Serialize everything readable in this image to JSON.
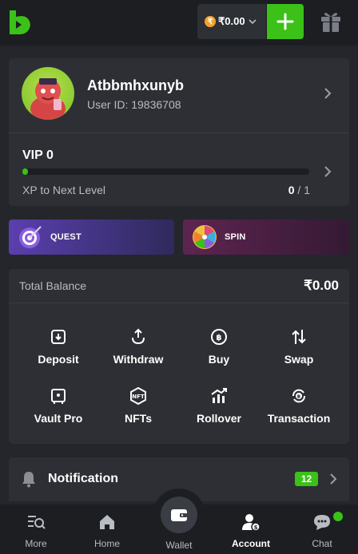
{
  "header": {
    "currency_symbol": "₹",
    "balance": "₹0.00",
    "accent": "#3bc117"
  },
  "profile": {
    "username": "Atbbmhxunyb",
    "user_id": "User ID: 19836708"
  },
  "vip": {
    "level": "VIP 0",
    "xp_label": "XP to Next Level",
    "xp_current": "0",
    "xp_sep": " / ",
    "xp_target": "1",
    "progress": 0.02
  },
  "banners": {
    "quest": "QUEST",
    "spin": "SPIN"
  },
  "wallet": {
    "total_label": "Total Balance",
    "total_value": "₹0.00",
    "actions": [
      {
        "label": "Deposit",
        "icon": "deposit-icon"
      },
      {
        "label": "Withdraw",
        "icon": "withdraw-icon"
      },
      {
        "label": "Buy",
        "icon": "buy-icon"
      },
      {
        "label": "Swap",
        "icon": "swap-icon"
      },
      {
        "label": "Vault Pro",
        "icon": "vault-icon"
      },
      {
        "label": "NFTs",
        "icon": "nft-icon"
      },
      {
        "label": "Rollover",
        "icon": "rollover-icon"
      },
      {
        "label": "Transaction",
        "icon": "transaction-icon"
      }
    ]
  },
  "notification": {
    "label": "Notification",
    "count": "12"
  },
  "nav": {
    "more": "More",
    "home": "Home",
    "wallet": "Wallet",
    "account": "Account",
    "chat": "Chat"
  }
}
